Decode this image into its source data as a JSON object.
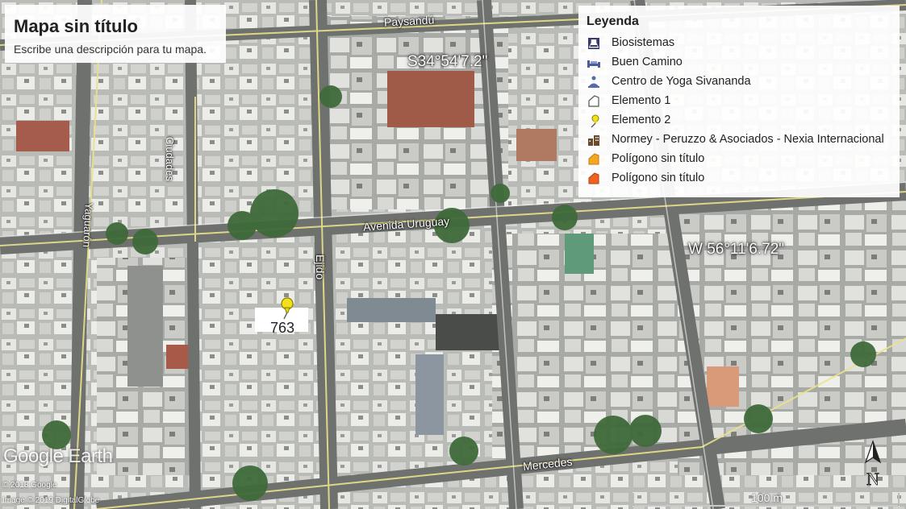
{
  "header": {
    "title": "Mapa sin título",
    "description": "Escribe una descripción para tu mapa."
  },
  "legend": {
    "title": "Leyenda",
    "items": [
      {
        "label": "Biosistemas",
        "icon": "flask-icon",
        "color": "#3a3a6a"
      },
      {
        "label": "Buen Camino",
        "icon": "bed-icon",
        "color": "#4a5a9a"
      },
      {
        "label": "Centro de Yoga Sivananda",
        "icon": "yoga-icon",
        "color": "#5a6aa8"
      },
      {
        "label": "Elemento 1",
        "icon": "polygon-outline-icon",
        "color": "#ffffff"
      },
      {
        "label": "Elemento 2",
        "icon": "pushpin-icon",
        "color": "#f2e01a"
      },
      {
        "label": "Normey - Peruzzo & Asociados - Nexia Internacional",
        "icon": "building-icon",
        "color": "#6a4a2a"
      },
      {
        "label": "Polígono sin título",
        "icon": "polygon-orange-icon",
        "color": "#f5a623"
      },
      {
        "label": "Polígono sin título",
        "icon": "polygon-red-orange-icon",
        "color": "#f06020"
      }
    ]
  },
  "map": {
    "streets": [
      "Paysandú",
      "Ciudades",
      "Yaguarón",
      "Avenida Uruguay",
      "Ejido",
      "Mercedes"
    ],
    "coordinates": {
      "latitude": "S34°54'7.2\"",
      "longitude": "W 56°11'6.72\""
    },
    "placemark": {
      "label": "763",
      "icon": "pushpin-icon"
    },
    "north_label": "N",
    "scale_label": "100 m"
  },
  "branding": {
    "watermark": "Google Earth",
    "copyright_1": "© 2018 Google",
    "copyright_2": "Image © 2019 DigitalGlobe"
  }
}
